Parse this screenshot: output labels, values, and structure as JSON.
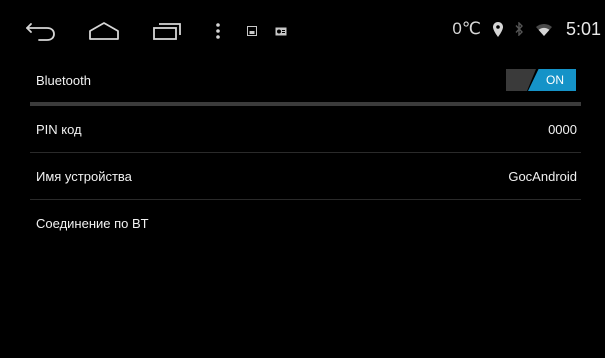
{
  "statusbar": {
    "nav_icons": [
      "back-icon",
      "home-icon",
      "recents-icon",
      "menu-dots-icon",
      "notification-image-icon",
      "radio-icon"
    ],
    "temperature": "0℃",
    "status_icons": [
      "location-icon",
      "bluetooth-icon",
      "wifi-icon"
    ],
    "clock": "5:01"
  },
  "settings": {
    "bluetooth_label": "Bluetooth",
    "bluetooth_toggle": "ON",
    "pin_label": "PIN код",
    "pin_value": "0000",
    "device_name_label": "Имя устройства",
    "device_name_value": "GocAndroid",
    "bt_connection_label": "Соединение по BT"
  },
  "colors": {
    "background": "#000000",
    "toggle_on": "#1593c8",
    "divider": "#2a2a2a"
  }
}
